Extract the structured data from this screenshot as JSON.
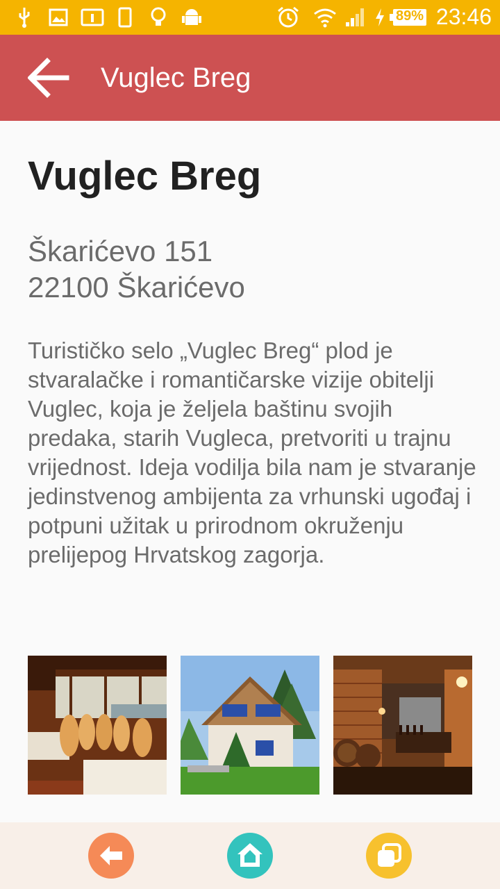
{
  "status_bar": {
    "battery_percent": "89%",
    "time": "23:46",
    "icons": [
      "usb-icon",
      "image-icon",
      "info-card-icon",
      "phone-icon",
      "lightbulb-icon",
      "android-icon",
      "alarm-clock-icon",
      "wifi-icon",
      "signal-icon",
      "charging-icon",
      "battery-icon"
    ]
  },
  "app_bar": {
    "title": "Vuglec Breg",
    "back_icon": "arrow-left-icon"
  },
  "main": {
    "title": "Vuglec Breg",
    "address_line1": "Škarićevo 151",
    "address_line2": "22100 Škarićevo",
    "description": "Turističko selo „Vuglec Breg“ plod je stvaralačke i romantičarske vizije obitelji Vuglec, koja je željela baštinu svojih predaka, starih Vugleca, pretvoriti u trajnu vrijednost. Ideja vodilja bila nam je stvaranje jedinstvenog ambijenta za vrhunski ugođaj i potpuni užitak u prirodnom okruženju prelijepog Hrvatskog zagorja.",
    "photos": [
      "restaurant-photo",
      "house-photo",
      "wine-cellar-photo"
    ]
  },
  "bottom_nav": {
    "items": [
      {
        "icon": "back-arrow-icon",
        "color": "#f58a57"
      },
      {
        "icon": "home-icon",
        "color": "#33c3bd"
      },
      {
        "icon": "pages-icon",
        "color": "#f7c12e"
      }
    ]
  },
  "colors": {
    "status_bar": "#f5b400",
    "app_bar": "#cd5152",
    "background": "#fafafa",
    "bottom_nav": "#f8efe8"
  }
}
